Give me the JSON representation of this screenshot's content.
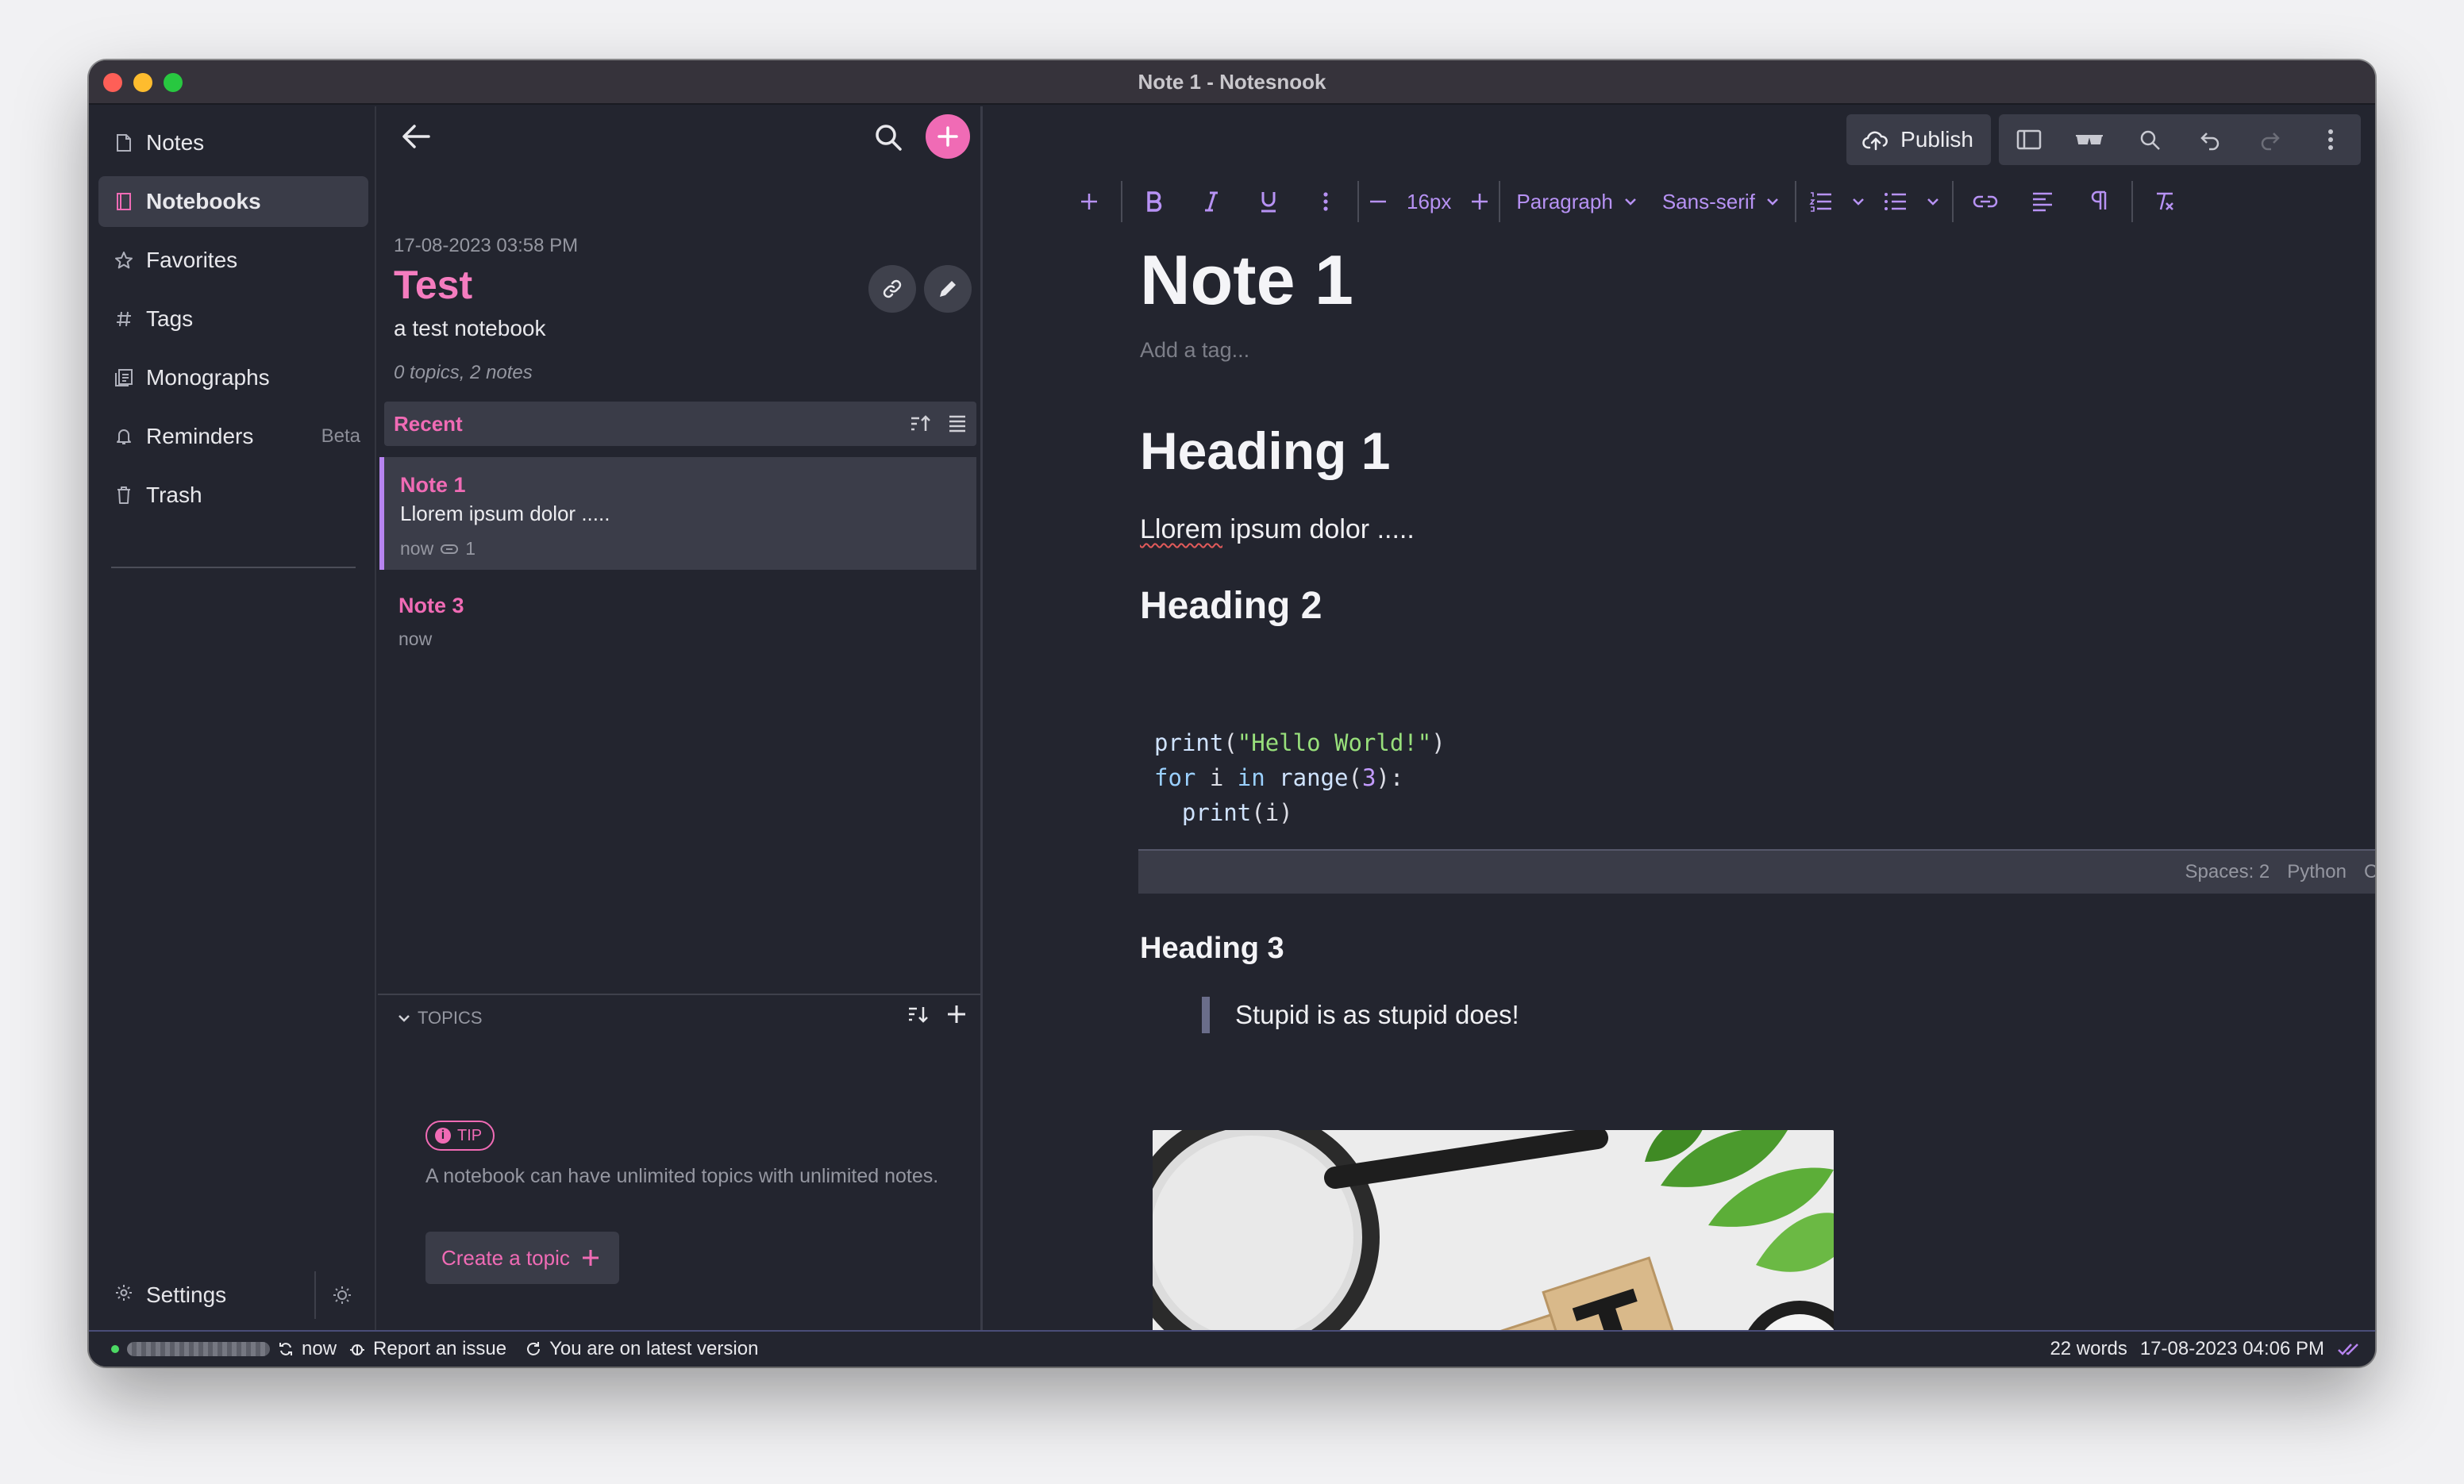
{
  "window": {
    "title": "Note 1 - Notesnook"
  },
  "nav": {
    "items": [
      {
        "label": "Notes",
        "icon": "note-icon"
      },
      {
        "label": "Notebooks",
        "icon": "notebook-icon",
        "active": true
      },
      {
        "label": "Favorites",
        "icon": "star-icon"
      },
      {
        "label": "Tags",
        "icon": "hash-icon"
      },
      {
        "label": "Monographs",
        "icon": "monograph-icon"
      },
      {
        "label": "Reminders",
        "icon": "bell-icon",
        "badge": "Beta"
      },
      {
        "label": "Trash",
        "icon": "trash-icon"
      }
    ],
    "settings_label": "Settings"
  },
  "notebook": {
    "date": "17-08-2023 03:58 PM",
    "title": "Test",
    "description": "a test notebook",
    "meta": "0 topics, 2 notes",
    "section_label": "Recent"
  },
  "notes": [
    {
      "title": "Note 1",
      "preview": "Llorem ipsum dolor .....",
      "time": "now",
      "count": "1",
      "active": true
    },
    {
      "title": "Note 3",
      "preview": "",
      "time": "now",
      "active": false
    }
  ],
  "topics": {
    "header": "TOPICS",
    "tip_badge": "TIP",
    "tip_text": "A notebook can have unlimited topics with unlimited notes.",
    "create_label": "Create a topic"
  },
  "editor": {
    "publish_label": "Publish",
    "font_size": "16px",
    "block_type": "Paragraph",
    "font_family": "Sans-serif",
    "title": "Note 1",
    "tag_placeholder": "Add a tag...",
    "heading1": "Heading 1",
    "paragraph_word": "Llorem",
    "paragraph_rest": " ipsum dolor .....",
    "heading2": "Heading 2",
    "code_footer": {
      "spaces": "Spaces: 2",
      "language": "Python",
      "copy": "Copy"
    },
    "heading3": "Heading 3",
    "quote": "Stupid is as stupid does!",
    "image_text": "EST"
  },
  "status": {
    "sync_time": "now",
    "report_label": "Report an issue",
    "version_label": "You are on latest version",
    "words": "22 words",
    "edited": "17-08-2023 04:06 PM"
  },
  "colors": {
    "accent": "#f06bb5",
    "toolbar_accent": "#b792f4",
    "background": "#23252f",
    "panel": "#3a3c48"
  }
}
